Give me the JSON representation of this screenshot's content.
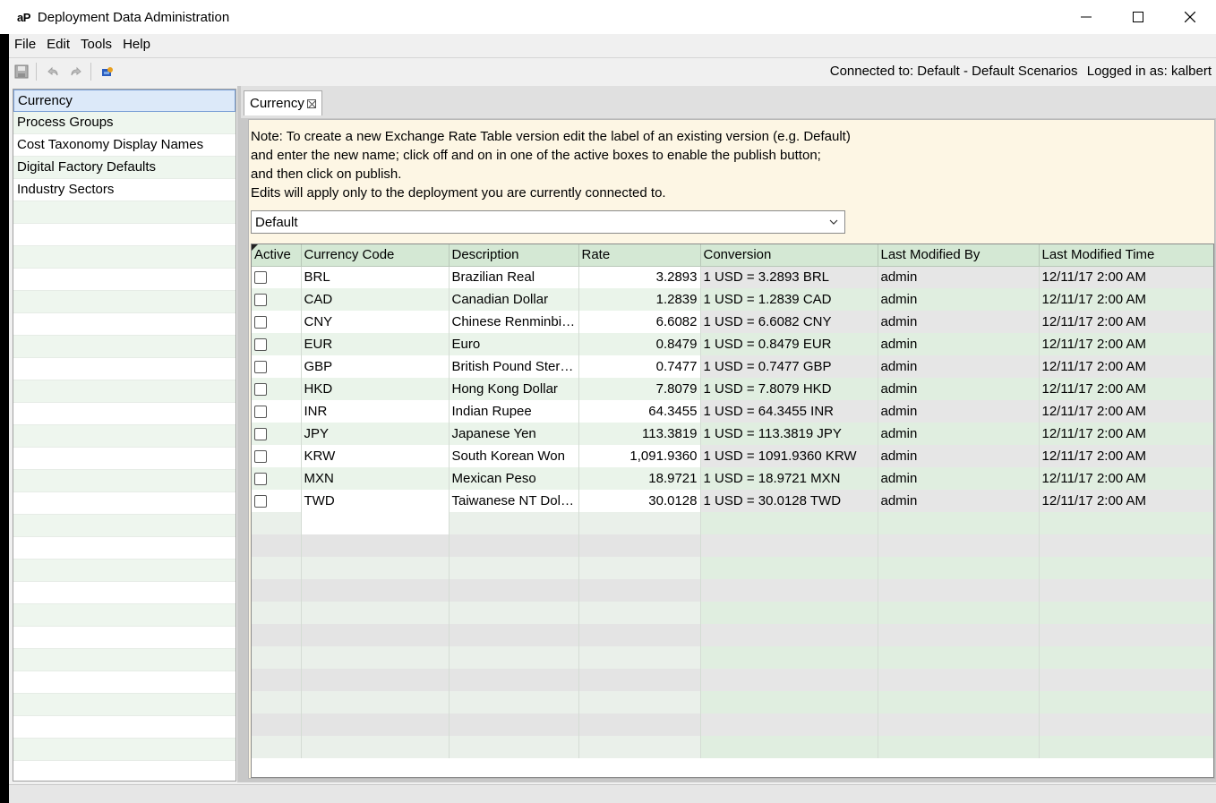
{
  "window": {
    "logo": "aP",
    "title": "Deployment Data Administration"
  },
  "menu": [
    "File",
    "Edit",
    "Tools",
    "Help"
  ],
  "toolbar": {
    "connection": "Connected to: Default - Default Scenarios",
    "user": "Logged in as: kalbert"
  },
  "nav": {
    "items": [
      "Currency",
      "Process Groups",
      "Cost Taxonomy Display Names",
      "Digital Factory Defaults",
      "Industry Sectors"
    ],
    "selected": "Currency"
  },
  "tab": {
    "label": "Currency"
  },
  "note": {
    "lines": [
      "Note: To create a new Exchange Rate Table version edit the label of an existing version (e.g. Default)",
      "and enter the new name; click off and on in one of the active boxes to enable the publish button;",
      "and then click on publish.",
      "Edits will apply only to the deployment you are currently connected to."
    ]
  },
  "version_select": {
    "value": "Default"
  },
  "grid": {
    "columns": [
      "Active",
      "Currency Code",
      "Description",
      "Rate",
      "Conversion",
      "Last Modified By",
      "Last Modified Time"
    ],
    "rows": [
      {
        "code": "BRL",
        "description": "Brazilian Real",
        "rate": "3.2893",
        "conversion": "1 USD = 3.2893 BRL",
        "by": "admin",
        "time": "12/11/17 2:00 AM"
      },
      {
        "code": "CAD",
        "description": "Canadian Dollar",
        "rate": "1.2839",
        "conversion": "1 USD = 1.2839 CAD",
        "by": "admin",
        "time": "12/11/17 2:00 AM"
      },
      {
        "code": "CNY",
        "description": "Chinese Renminbi Y...",
        "rate": "6.6082",
        "conversion": "1 USD = 6.6082 CNY",
        "by": "admin",
        "time": "12/11/17 2:00 AM"
      },
      {
        "code": "EUR",
        "description": "Euro",
        "rate": "0.8479",
        "conversion": "1 USD = 0.8479 EUR",
        "by": "admin",
        "time": "12/11/17 2:00 AM"
      },
      {
        "code": "GBP",
        "description": "British Pound Sterli...",
        "rate": "0.7477",
        "conversion": "1 USD = 0.7477 GBP",
        "by": "admin",
        "time": "12/11/17 2:00 AM"
      },
      {
        "code": "HKD",
        "description": "Hong Kong Dollar",
        "rate": "7.8079",
        "conversion": "1 USD = 7.8079 HKD",
        "by": "admin",
        "time": "12/11/17 2:00 AM"
      },
      {
        "code": "INR",
        "description": "Indian Rupee",
        "rate": "64.3455",
        "conversion": "1 USD = 64.3455 INR",
        "by": "admin",
        "time": "12/11/17 2:00 AM"
      },
      {
        "code": "JPY",
        "description": "Japanese Yen",
        "rate": "113.3819",
        "conversion": "1 USD = 113.3819 JPY",
        "by": "admin",
        "time": "12/11/17 2:00 AM"
      },
      {
        "code": "KRW",
        "description": "South Korean Won",
        "rate": "1,091.9360",
        "conversion": "1 USD = 1091.9360 KRW",
        "by": "admin",
        "time": "12/11/17 2:00 AM"
      },
      {
        "code": "MXN",
        "description": "Mexican Peso",
        "rate": "18.9721",
        "conversion": "1 USD = 18.9721 MXN",
        "by": "admin",
        "time": "12/11/17 2:00 AM"
      },
      {
        "code": "TWD",
        "description": "Taiwanese NT Dollar",
        "rate": "30.0128",
        "conversion": "1 USD = 30.0128 TWD",
        "by": "admin",
        "time": "12/11/17 2:00 AM"
      }
    ]
  },
  "colors": {
    "header_green": "#d4e8d4",
    "row_alt_green": "#eaf4ea",
    "note_bg": "#fdf6e4",
    "selection_blue": "#dce9f9"
  }
}
